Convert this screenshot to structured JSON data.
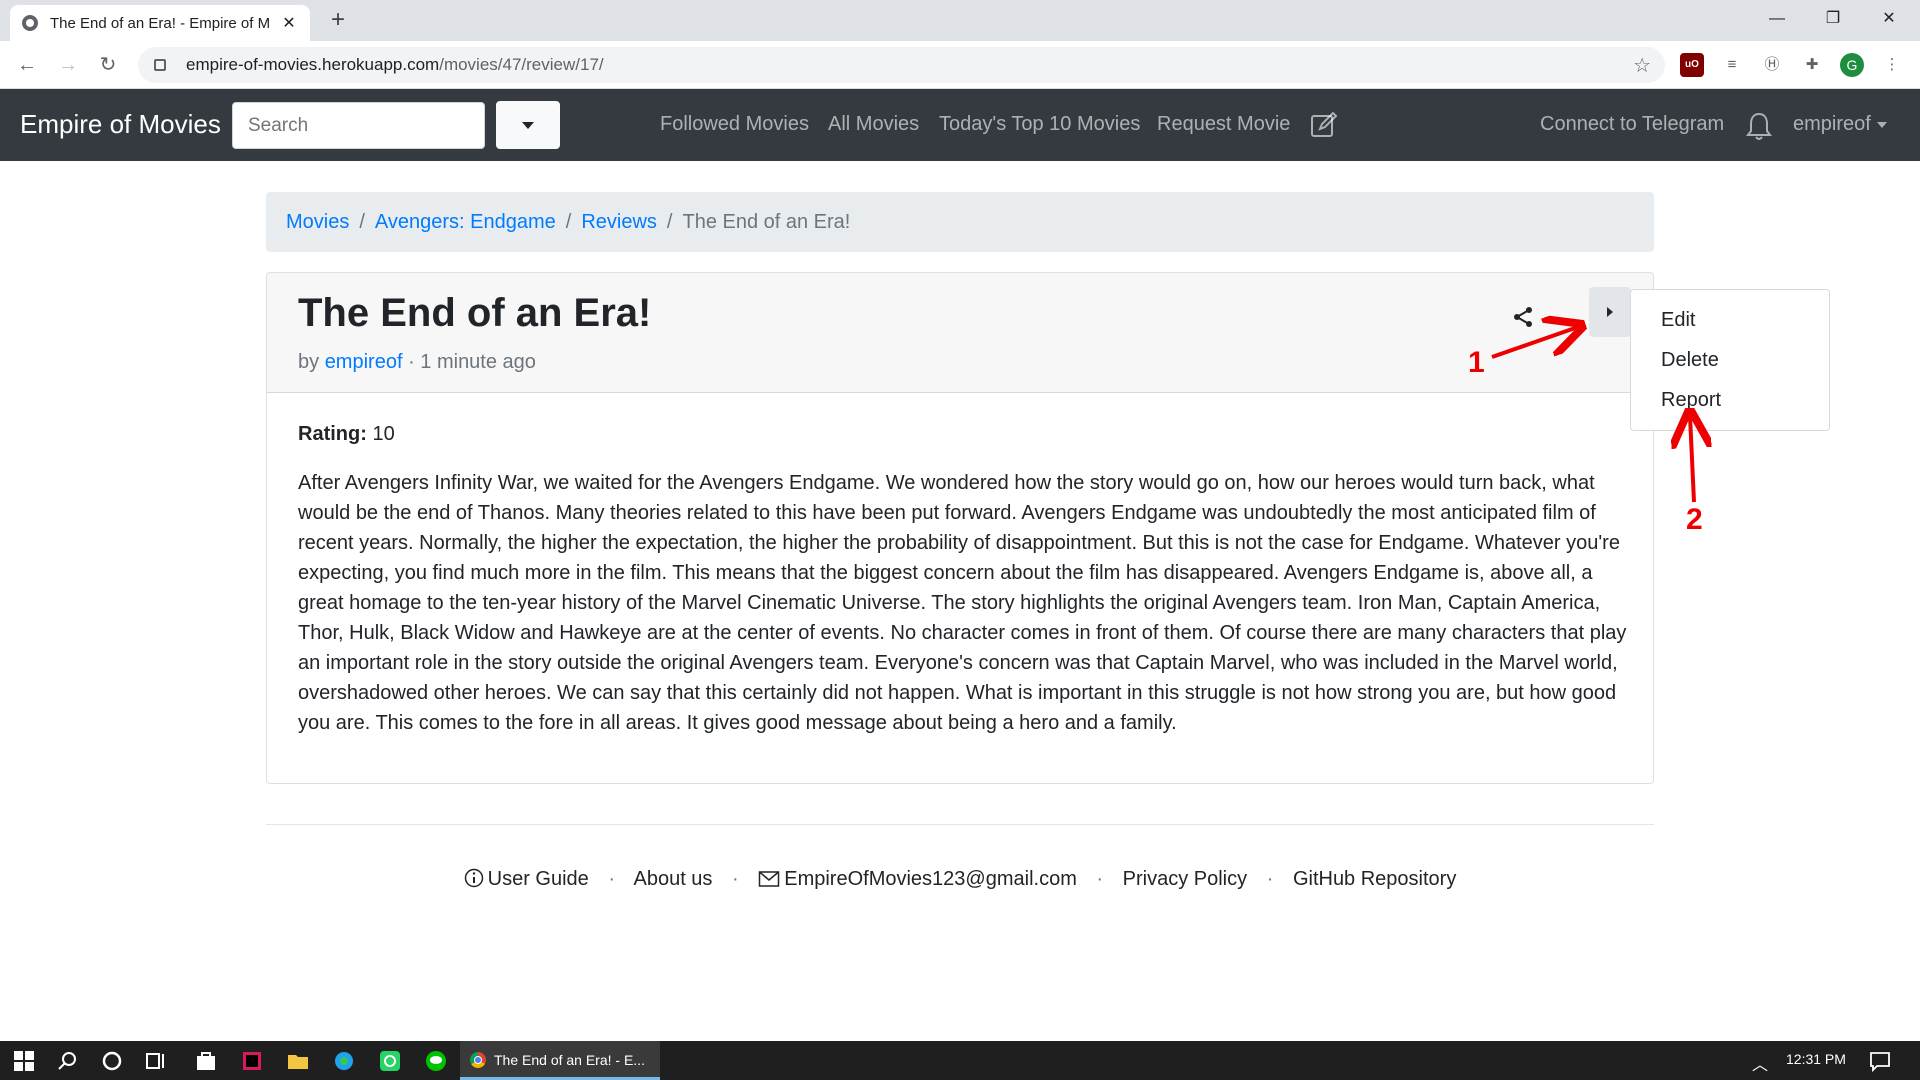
{
  "browser": {
    "tab_title": "The End of an Era! - Empire of M",
    "url_host": "empire-of-movies.herokuapp.com",
    "url_path": "/movies/47/review/17/",
    "avatar_letter": "G",
    "ublock_label": "uO"
  },
  "navbar": {
    "brand": "Empire of Movies",
    "search_placeholder": "Search",
    "links": [
      "Followed Movies",
      "All Movies",
      "Today's Top 10 Movies",
      "Request Movie"
    ],
    "telegram": "Connect to Telegram",
    "user": "empireof"
  },
  "breadcrumb": {
    "items": [
      "Movies",
      "Avengers: Endgame",
      "Reviews"
    ],
    "active": "The End of an Era!",
    "separator": "/"
  },
  "review": {
    "title": "The End of an Era!",
    "by": "by",
    "author": "empireof",
    "time": "· 1 minute ago",
    "rating_label": "Rating:",
    "rating_value": "10",
    "text": "After Avengers Infinity War, we waited for the Avengers Endgame. We wondered how the story would go on, how our heroes would turn back, what would be the end of Thanos. Many theories related to this have been put forward. Avengers Endgame was undoubtedly the most anticipated film of recent years. Normally, the higher the expectation, the higher the probability of disappointment. But this is not the case for Endgame. Whatever you're expecting, you find much more in the film. This means that the biggest concern about the film has disappeared. Avengers Endgame is, above all, a great homage to the ten-year history of the Marvel Cinematic Universe. The story highlights the original Avengers team. Iron Man, Captain America, Thor, Hulk, Black Widow and Hawkeye are at the center of events. No character comes in front of them. Of course there are many characters that play an important role in the story outside the original Avengers team. Everyone's concern was that Captain Marvel, who was included in the Marvel world, overshadowed other heroes. We can say that this certainly did not happen. What is important in this struggle is not how strong you are, but how good you are. This comes to the fore in all areas. It gives good message about being a hero and a family."
  },
  "dropdown": {
    "items": [
      "Edit",
      "Delete",
      "Report"
    ]
  },
  "annotations": {
    "label_1": "1",
    "label_2": "2",
    "color": "#e00000"
  },
  "footer": {
    "user_guide": "User Guide",
    "about": "About us",
    "email": "EmpireOfMovies123@gmail.com",
    "privacy": "Privacy Policy",
    "github": "GitHub Repository",
    "separator": "·"
  },
  "taskbar": {
    "active_window": "The End of an Era! - E...",
    "time": "12:31 PM"
  },
  "colors": {
    "navbar_bg": "#343a40",
    "link": "#007bff",
    "breadcrumb_bg": "#e9ecef"
  }
}
